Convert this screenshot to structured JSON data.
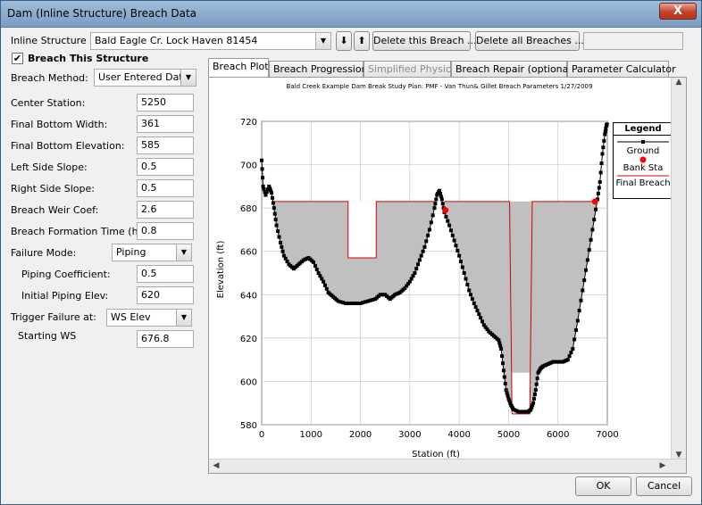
{
  "window": {
    "title": "Dam (Inline Structure) Breach Data",
    "close_glyph": "X"
  },
  "top": {
    "inline_structure_label": "Inline Structure",
    "inline_structure_value": "Bald Eagle Cr.  Lock Haven      81454",
    "down_arrow": "⬇",
    "up_arrow": "⬆",
    "delete_breach": "Delete this Breach ...",
    "delete_all": "Delete all Breaches ..."
  },
  "left": {
    "breach_check_label": "Breach This Structure",
    "breach_checked": "✔",
    "breach_method_label": "Breach Method:",
    "breach_method_value": "User Entered Data",
    "fields": [
      {
        "label": "Center Station:",
        "value": "5250"
      },
      {
        "label": "Final Bottom Width:",
        "value": "361"
      },
      {
        "label": "Final Bottom Elevation:",
        "value": "585"
      },
      {
        "label": "Left Side Slope:",
        "value": "0.5"
      },
      {
        "label": "Right Side Slope:",
        "value": "0.5"
      },
      {
        "label": "Breach Weir Coef:",
        "value": "2.6"
      },
      {
        "label": "Breach Formation Time (hrs):",
        "value": "0.8"
      }
    ],
    "failure_mode_label": "Failure Mode:",
    "failure_mode_value": "Piping",
    "piping_coef_label": "Piping Coefficient:",
    "piping_coef_value": "0.5",
    "initial_piping_label": "Initial Piping Elev:",
    "initial_piping_value": "620",
    "trigger_label": "Trigger Failure at:",
    "trigger_value": "WS Elev",
    "starting_ws_label": "Starting WS",
    "starting_ws_value": "676.8"
  },
  "tabs": [
    {
      "label": "Breach Plot"
    },
    {
      "label": "Breach Progression"
    },
    {
      "label": "Simplified Physical"
    },
    {
      "label": "Breach Repair (optional)"
    },
    {
      "label": "Parameter Calculator"
    }
  ],
  "buttons": {
    "ok": "OK",
    "cancel": "Cancel"
  },
  "chart_data": {
    "type": "line",
    "subtitle": "Bald Creek Example Dam Break Study        Plan: PMF - Van Thun& Gillet Breach Parameters     1/27/2009",
    "xlabel": "Station (ft)",
    "ylabel": "Elevation (ft)",
    "xlim": [
      0,
      7000
    ],
    "ylim": [
      580,
      720
    ],
    "xticks": [
      0,
      1000,
      2000,
      3000,
      4000,
      5000,
      6000,
      7000
    ],
    "yticks": [
      580,
      600,
      620,
      640,
      660,
      680,
      700,
      720
    ],
    "legend": {
      "title": "Legend",
      "items": [
        "Ground",
        "Bank Sta",
        "Final Breach"
      ]
    },
    "colors": {
      "ground": "#000000",
      "bank": "#ff0000",
      "breach": "#d40000",
      "fill": "#c0c0c0"
    },
    "ground": [
      [
        0,
        702
      ],
      [
        30,
        690
      ],
      [
        80,
        686
      ],
      [
        150,
        690
      ],
      [
        200,
        687
      ],
      [
        250,
        680
      ],
      [
        300,
        672
      ],
      [
        380,
        664
      ],
      [
        450,
        658
      ],
      [
        550,
        654
      ],
      [
        650,
        652
      ],
      [
        750,
        654
      ],
      [
        850,
        656
      ],
      [
        950,
        657
      ],
      [
        1050,
        655
      ],
      [
        1150,
        650
      ],
      [
        1250,
        646
      ],
      [
        1350,
        641
      ],
      [
        1450,
        639
      ],
      [
        1550,
        637
      ],
      [
        1700,
        636
      ],
      [
        1850,
        636
      ],
      [
        2000,
        636
      ],
      [
        2150,
        637
      ],
      [
        2300,
        638
      ],
      [
        2400,
        640
      ],
      [
        2500,
        640
      ],
      [
        2600,
        638
      ],
      [
        2700,
        640
      ],
      [
        2800,
        641
      ],
      [
        2900,
        643
      ],
      [
        3000,
        646
      ],
      [
        3100,
        650
      ],
      [
        3200,
        656
      ],
      [
        3300,
        662
      ],
      [
        3400,
        670
      ],
      [
        3500,
        680
      ],
      [
        3550,
        686
      ],
      [
        3600,
        688
      ],
      [
        3650,
        684
      ],
      [
        3700,
        678
      ],
      [
        3800,
        672
      ],
      [
        3900,
        665
      ],
      [
        4000,
        658
      ],
      [
        4100,
        650
      ],
      [
        4200,
        642
      ],
      [
        4300,
        636
      ],
      [
        4400,
        631
      ],
      [
        4500,
        626
      ],
      [
        4600,
        623
      ],
      [
        4700,
        621
      ],
      [
        4800,
        619
      ],
      [
        4850,
        615
      ],
      [
        4900,
        605
      ],
      [
        4950,
        596
      ],
      [
        5000,
        592
      ],
      [
        5050,
        589
      ],
      [
        5100,
        587
      ],
      [
        5200,
        586
      ],
      [
        5300,
        586
      ],
      [
        5400,
        586
      ],
      [
        5450,
        587
      ],
      [
        5500,
        590
      ],
      [
        5550,
        596
      ],
      [
        5600,
        604
      ],
      [
        5650,
        606
      ],
      [
        5700,
        607
      ],
      [
        5800,
        608
      ],
      [
        5900,
        609
      ],
      [
        6000,
        609
      ],
      [
        6100,
        609
      ],
      [
        6200,
        610
      ],
      [
        6300,
        615
      ],
      [
        6400,
        628
      ],
      [
        6500,
        642
      ],
      [
        6600,
        656
      ],
      [
        6700,
        670
      ],
      [
        6800,
        684
      ],
      [
        6850,
        692
      ],
      [
        6900,
        705
      ],
      [
        6950,
        714
      ],
      [
        6980,
        718
      ],
      [
        7000,
        719
      ]
    ],
    "bank_stations": [
      [
        3720,
        679
      ],
      [
        6750,
        683
      ]
    ],
    "top_of_dam": 683,
    "weir_notch": {
      "x1": 1750,
      "x2": 2320,
      "elev": 657
    },
    "final_breach": {
      "bottom_left": 5070,
      "bottom_right": 5430,
      "bottom_elev": 585,
      "top_left": 5020,
      "top_right": 5480
    }
  }
}
